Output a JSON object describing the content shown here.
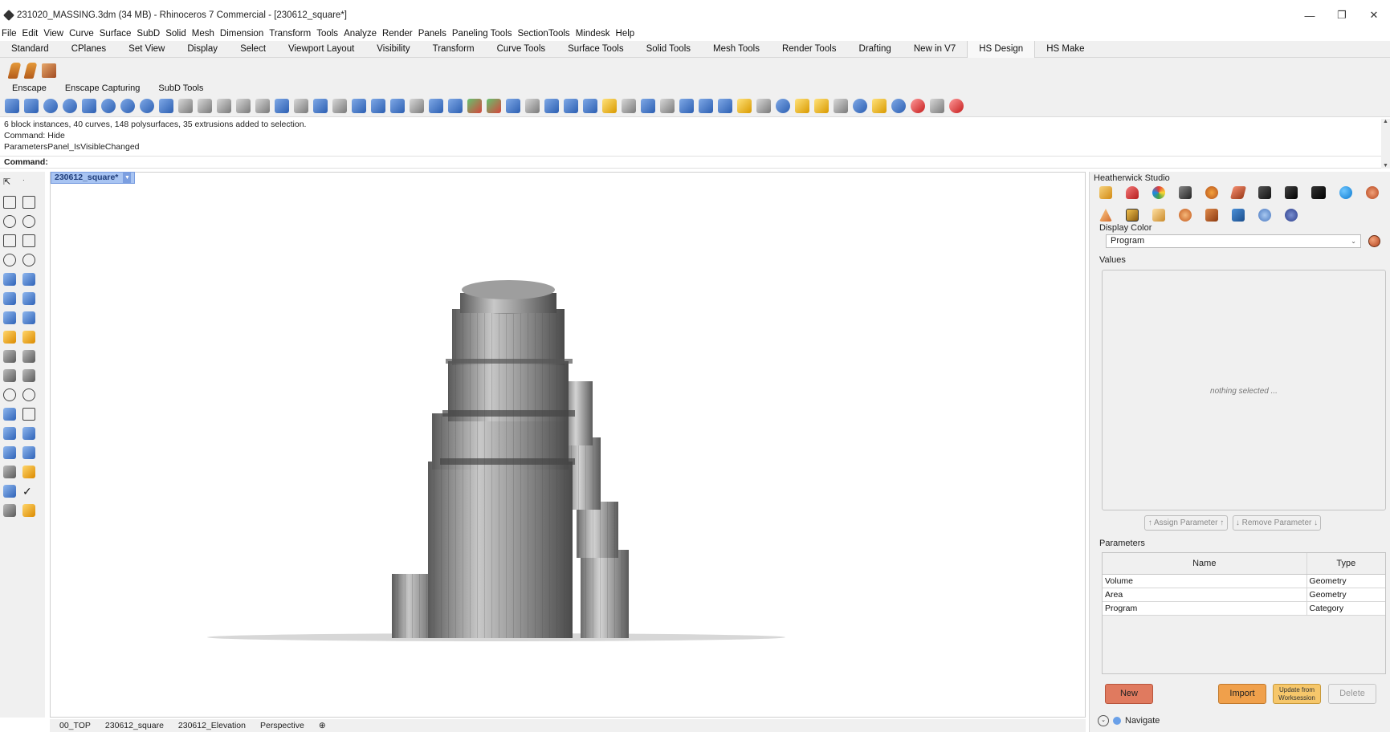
{
  "window": {
    "title": "231020_MASSING.3dm (34 MB) - Rhinoceros 7 Commercial - [230612_square*]",
    "minimize": "—",
    "restore": "❐",
    "close": "✕"
  },
  "menu": [
    "File",
    "Edit",
    "View",
    "Curve",
    "Surface",
    "SubD",
    "Solid",
    "Mesh",
    "Dimension",
    "Transform",
    "Tools",
    "Analyze",
    "Render",
    "Panels",
    "Paneling Tools",
    "SectionTools",
    "Mindesk",
    "Help"
  ],
  "toolbar_tabs": [
    "Standard",
    "CPlanes",
    "Set View",
    "Display",
    "Select",
    "Viewport Layout",
    "Visibility",
    "Transform",
    "Curve Tools",
    "Surface Tools",
    "Solid Tools",
    "Mesh Tools",
    "Render Tools",
    "Drafting",
    "New in V7",
    "HS Design",
    "HS Make"
  ],
  "active_toolbar_tab": "HS Design",
  "toolbar_tabs2": [
    "Enscape",
    "Enscape Capturing",
    "SubD Tools"
  ],
  "command_history": [
    "6 block instances, 40 curves, 148 polysurfaces, 35 extrusions added to selection.",
    "Command: Hide",
    "ParametersPanel_IsVisibleChanged"
  ],
  "command_prompt": "Command:",
  "viewport": {
    "tab_label": "230612_square*",
    "dropdown_icon": "▼"
  },
  "right_panel": {
    "title": "Heatherwick Studio",
    "display_color_label": "Display Color",
    "display_color_value": "Program",
    "values_label": "Values",
    "nothing_selected": "nothing selected ...",
    "assign_button": "↑ Assign Parameter ↑",
    "remove_button": "↓ Remove Parameter ↓",
    "parameters_label": "Parameters",
    "columns": [
      "Name",
      "Type"
    ],
    "rows": [
      {
        "name": "Volume",
        "type": "Geometry"
      },
      {
        "name": "Area",
        "type": "Geometry"
      },
      {
        "name": "Program",
        "type": "Category"
      }
    ],
    "new_button": "New",
    "import_button": "Import",
    "update_button_line1": "Update from",
    "update_button_line2": "Worksession",
    "delete_button": "Delete",
    "navigate_label": "Navigate",
    "colors": {
      "new_btn": "#e07a5f",
      "import_btn": "#f0a04b",
      "update_btn": "#f6c76b"
    }
  },
  "status_bar": [
    "00_TOP",
    "230612_square",
    "230612_Elevation",
    "Perspective",
    "⊕"
  ]
}
